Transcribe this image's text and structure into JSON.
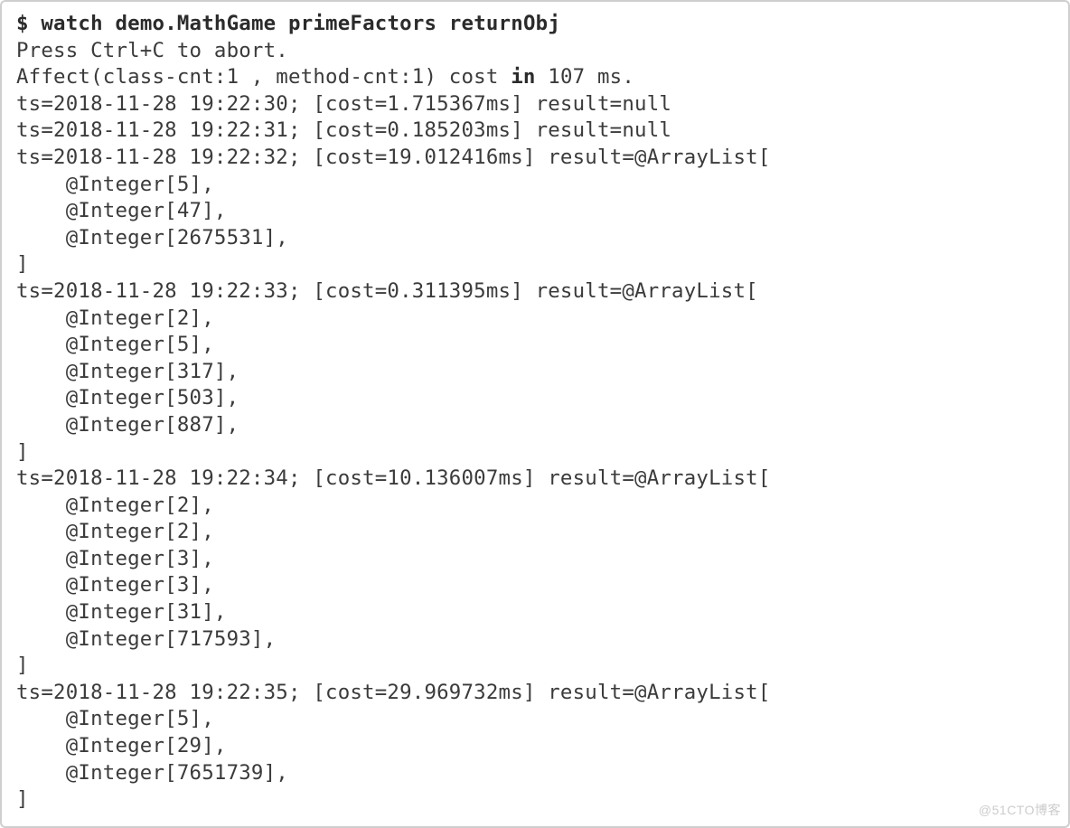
{
  "prompt": "$",
  "command": {
    "watch": "watch",
    "class": "demo.MathGame",
    "method": "primeFactors",
    "arg": "returnObj"
  },
  "abort_hint": "Press Ctrl+C to abort.",
  "affect": {
    "prefix": "Affect(class-cnt:1 , method-cnt:1) cost ",
    "in": "in",
    "ms": " 107 ms."
  },
  "entries": [
    {
      "ts": "2018-11-28 19:22:30",
      "cost": "1.715367ms",
      "result_plain": "null"
    },
    {
      "ts": "2018-11-28 19:22:31",
      "cost": "0.185203ms",
      "result_plain": "null"
    },
    {
      "ts": "2018-11-28 19:22:32",
      "cost": "19.012416ms",
      "list": [
        5,
        47,
        2675531
      ]
    },
    {
      "ts": "2018-11-28 19:22:33",
      "cost": "0.311395ms",
      "list": [
        2,
        5,
        317,
        503,
        887
      ]
    },
    {
      "ts": "2018-11-28 19:22:34",
      "cost": "10.136007ms",
      "list": [
        2,
        2,
        3,
        3,
        31,
        717593
      ]
    },
    {
      "ts": "2018-11-28 19:22:35",
      "cost": "29.969732ms",
      "list": [
        5,
        29,
        7651739
      ]
    }
  ],
  "watermark": "@51CTO博客"
}
